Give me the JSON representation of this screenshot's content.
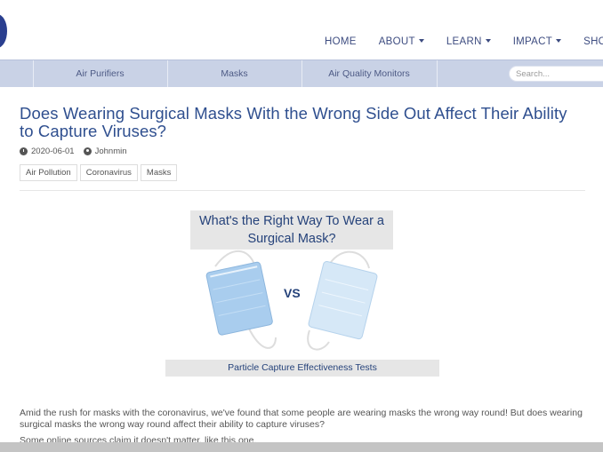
{
  "topnav": {
    "home": "HOME",
    "about": "ABOUT",
    "learn": "LEARN",
    "impact": "IMPACT",
    "shop": "SHOP"
  },
  "subnav": {
    "items": [
      "Air Purifiers",
      "Masks",
      "Air Quality Monitors"
    ],
    "search_placeholder": "Search..."
  },
  "article": {
    "title": "Does Wearing Surgical Masks With the Wrong Side Out Affect Their Ability to Capture Viruses?",
    "date": "2020-06-01",
    "author": "Johnmin",
    "tags": [
      "Air Pollution",
      "Coronavirus",
      "Masks"
    ],
    "image": {
      "heading": "What's the Right Way To Wear a Surgical Mask?",
      "vs": "VS",
      "caption": "Particle Capture Effectiveness Tests"
    },
    "paragraph1": "Amid the rush for masks with the coronavirus, we've found that some people are wearing masks the wrong way round! But does wearing surgical masks the wrong way round affect their ability to capture viruses?",
    "paragraph2": "Some online sources claim it doesn't matter, like this one."
  },
  "colors": {
    "brand": "#2a3f8f",
    "title": "#2f4f8f",
    "subnav_bg": "#c9d2e6",
    "mask_blue": "#a9cdee"
  }
}
